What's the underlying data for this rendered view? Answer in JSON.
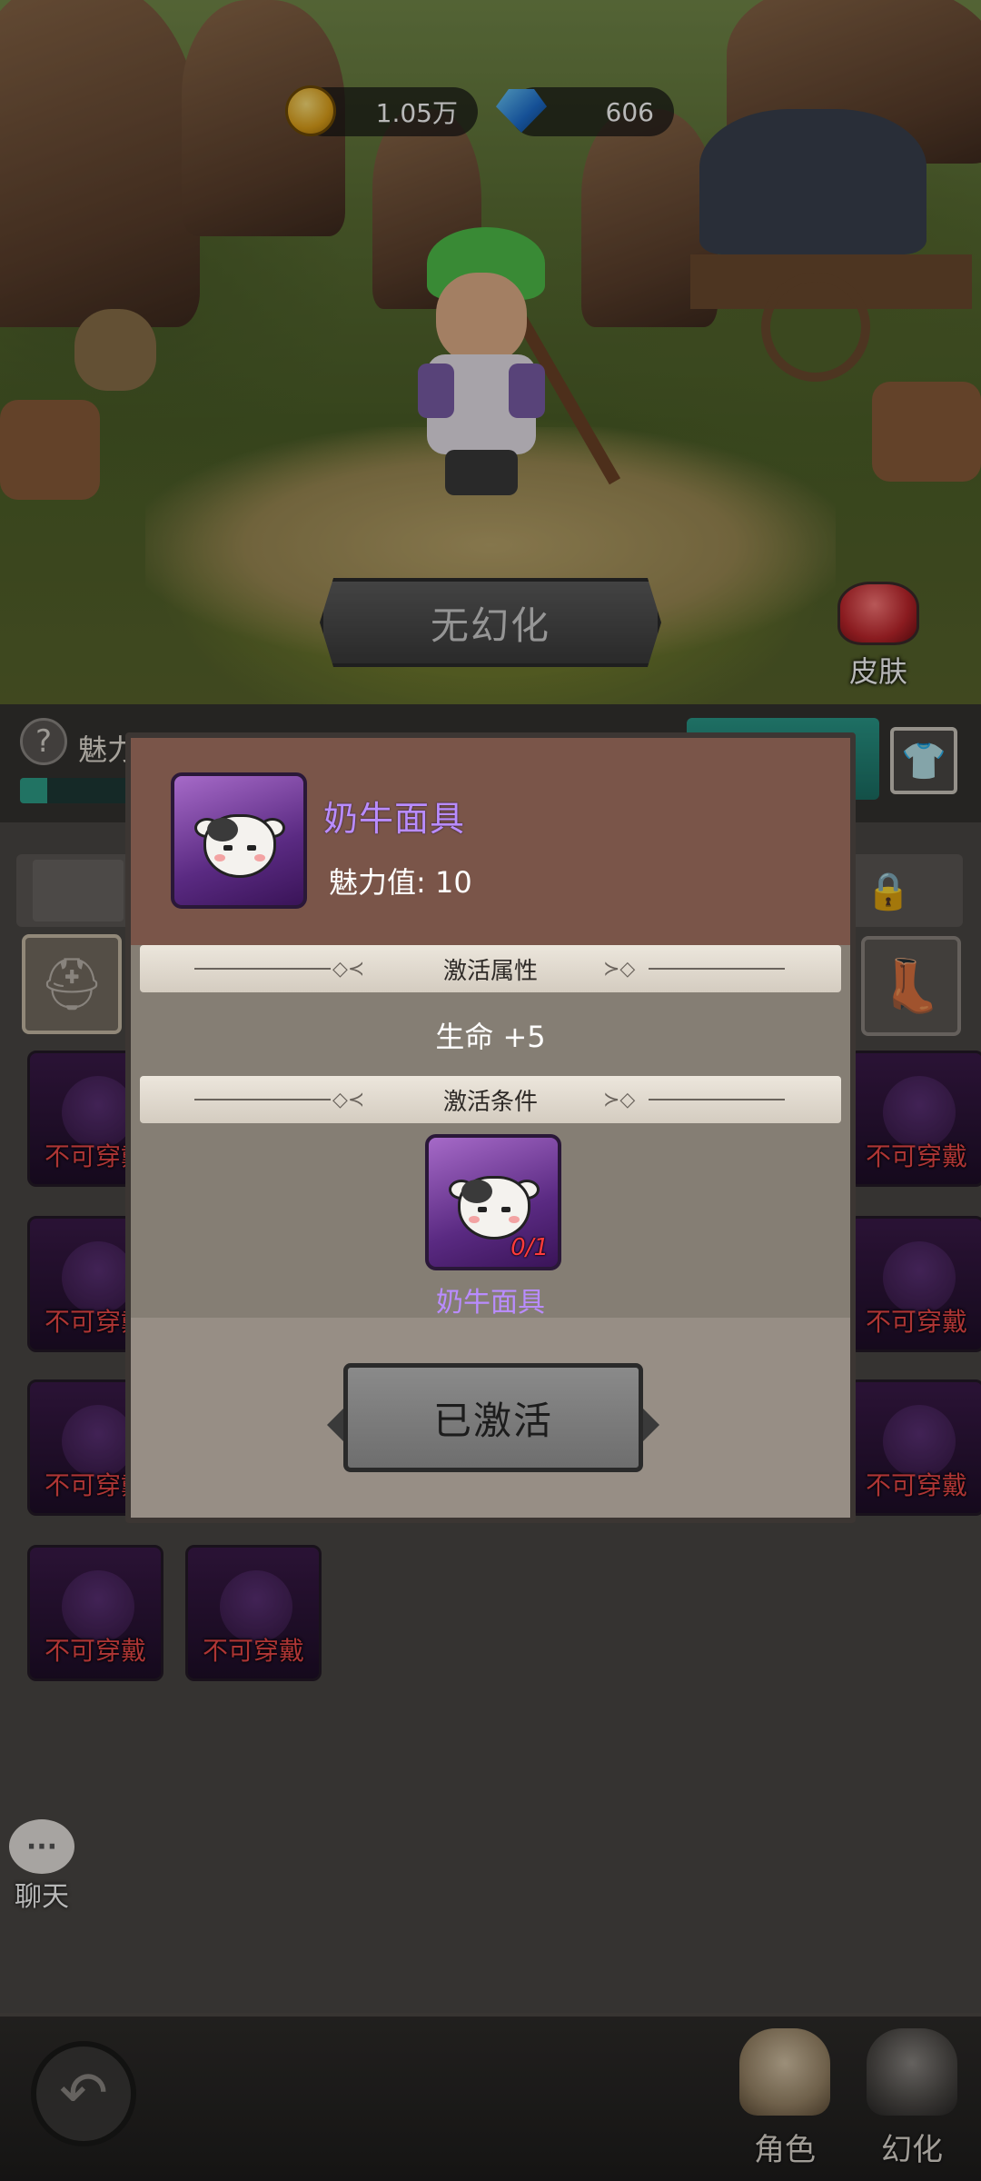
{
  "currency": {
    "gold": "1.05万",
    "gems": "606"
  },
  "scene": {
    "no_transform_label": "无幻化",
    "skin_label": "皮肤"
  },
  "panel": {
    "charm_label": "魅力",
    "charm_fraction": 0.1,
    "items": [
      {
        "status": "不可穿戴"
      },
      {
        "status": "不可穿戴"
      },
      {
        "status": "不可穿戴"
      },
      {
        "status": "不可穿戴"
      },
      {
        "status": "不可穿戴"
      },
      {
        "status": "不可穿戴"
      },
      {
        "status": "不可穿戴"
      },
      {
        "status": "不可穿戴"
      }
    ],
    "chat_label": "聊天",
    "chat_icon": "···"
  },
  "nav": {
    "role_label": "角色",
    "transform_label": "幻化"
  },
  "modal": {
    "item_name": "奶牛面具",
    "charm_value": "魅力值: 10",
    "attr_header": "激活属性",
    "attr_text": "生命 +5",
    "cond_header": "激活条件",
    "cond_count": "0/1",
    "cond_item_name": "奶牛面具",
    "activated_label": "已激活"
  },
  "colors": {
    "item_name": "#b98cff",
    "unwearable": "#f04a4a",
    "count_red": "#ff3b3b",
    "teal": "#2ea08a"
  }
}
